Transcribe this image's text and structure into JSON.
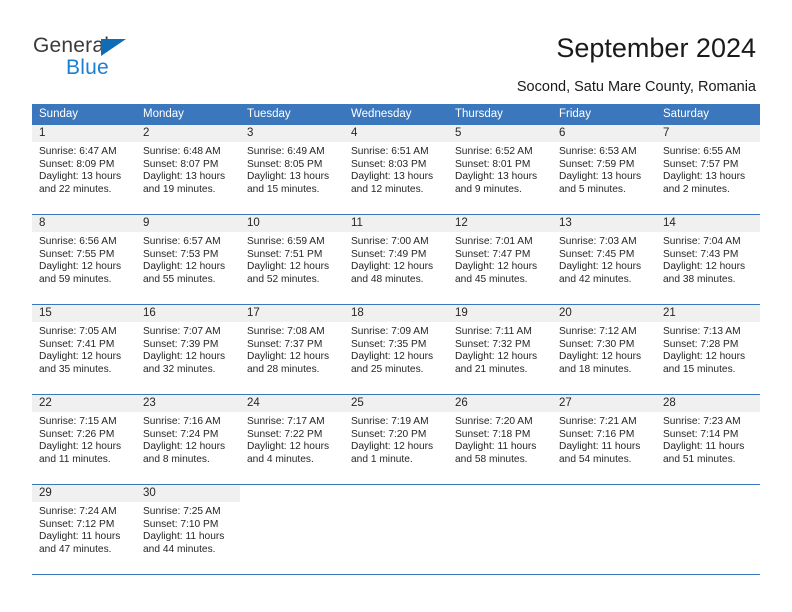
{
  "brand": {
    "name_top": "General",
    "name_bottom": "Blue",
    "accent_color": "#1b7fd4",
    "triangle_color": "#0f6cb5"
  },
  "header": {
    "title": "September 2024",
    "subtitle": "Socond, Satu Mare County, Romania",
    "header_bg": "#3b77bd",
    "header_text_color": "#ffffff",
    "daynum_band_bg": "#f0f0f0"
  },
  "weekdays": [
    "Sunday",
    "Monday",
    "Tuesday",
    "Wednesday",
    "Thursday",
    "Friday",
    "Saturday"
  ],
  "weeks": [
    [
      {
        "num": "1",
        "sunrise": "Sunrise: 6:47 AM",
        "sunset": "Sunset: 8:09 PM",
        "daylight1": "Daylight: 13 hours",
        "daylight2": "and 22 minutes."
      },
      {
        "num": "2",
        "sunrise": "Sunrise: 6:48 AM",
        "sunset": "Sunset: 8:07 PM",
        "daylight1": "Daylight: 13 hours",
        "daylight2": "and 19 minutes."
      },
      {
        "num": "3",
        "sunrise": "Sunrise: 6:49 AM",
        "sunset": "Sunset: 8:05 PM",
        "daylight1": "Daylight: 13 hours",
        "daylight2": "and 15 minutes."
      },
      {
        "num": "4",
        "sunrise": "Sunrise: 6:51 AM",
        "sunset": "Sunset: 8:03 PM",
        "daylight1": "Daylight: 13 hours",
        "daylight2": "and 12 minutes."
      },
      {
        "num": "5",
        "sunrise": "Sunrise: 6:52 AM",
        "sunset": "Sunset: 8:01 PM",
        "daylight1": "Daylight: 13 hours",
        "daylight2": "and 9 minutes."
      },
      {
        "num": "6",
        "sunrise": "Sunrise: 6:53 AM",
        "sunset": "Sunset: 7:59 PM",
        "daylight1": "Daylight: 13 hours",
        "daylight2": "and 5 minutes."
      },
      {
        "num": "7",
        "sunrise": "Sunrise: 6:55 AM",
        "sunset": "Sunset: 7:57 PM",
        "daylight1": "Daylight: 13 hours",
        "daylight2": "and 2 minutes."
      }
    ],
    [
      {
        "num": "8",
        "sunrise": "Sunrise: 6:56 AM",
        "sunset": "Sunset: 7:55 PM",
        "daylight1": "Daylight: 12 hours",
        "daylight2": "and 59 minutes."
      },
      {
        "num": "9",
        "sunrise": "Sunrise: 6:57 AM",
        "sunset": "Sunset: 7:53 PM",
        "daylight1": "Daylight: 12 hours",
        "daylight2": "and 55 minutes."
      },
      {
        "num": "10",
        "sunrise": "Sunrise: 6:59 AM",
        "sunset": "Sunset: 7:51 PM",
        "daylight1": "Daylight: 12 hours",
        "daylight2": "and 52 minutes."
      },
      {
        "num": "11",
        "sunrise": "Sunrise: 7:00 AM",
        "sunset": "Sunset: 7:49 PM",
        "daylight1": "Daylight: 12 hours",
        "daylight2": "and 48 minutes."
      },
      {
        "num": "12",
        "sunrise": "Sunrise: 7:01 AM",
        "sunset": "Sunset: 7:47 PM",
        "daylight1": "Daylight: 12 hours",
        "daylight2": "and 45 minutes."
      },
      {
        "num": "13",
        "sunrise": "Sunrise: 7:03 AM",
        "sunset": "Sunset: 7:45 PM",
        "daylight1": "Daylight: 12 hours",
        "daylight2": "and 42 minutes."
      },
      {
        "num": "14",
        "sunrise": "Sunrise: 7:04 AM",
        "sunset": "Sunset: 7:43 PM",
        "daylight1": "Daylight: 12 hours",
        "daylight2": "and 38 minutes."
      }
    ],
    [
      {
        "num": "15",
        "sunrise": "Sunrise: 7:05 AM",
        "sunset": "Sunset: 7:41 PM",
        "daylight1": "Daylight: 12 hours",
        "daylight2": "and 35 minutes."
      },
      {
        "num": "16",
        "sunrise": "Sunrise: 7:07 AM",
        "sunset": "Sunset: 7:39 PM",
        "daylight1": "Daylight: 12 hours",
        "daylight2": "and 32 minutes."
      },
      {
        "num": "17",
        "sunrise": "Sunrise: 7:08 AM",
        "sunset": "Sunset: 7:37 PM",
        "daylight1": "Daylight: 12 hours",
        "daylight2": "and 28 minutes."
      },
      {
        "num": "18",
        "sunrise": "Sunrise: 7:09 AM",
        "sunset": "Sunset: 7:35 PM",
        "daylight1": "Daylight: 12 hours",
        "daylight2": "and 25 minutes."
      },
      {
        "num": "19",
        "sunrise": "Sunrise: 7:11 AM",
        "sunset": "Sunset: 7:32 PM",
        "daylight1": "Daylight: 12 hours",
        "daylight2": "and 21 minutes."
      },
      {
        "num": "20",
        "sunrise": "Sunrise: 7:12 AM",
        "sunset": "Sunset: 7:30 PM",
        "daylight1": "Daylight: 12 hours",
        "daylight2": "and 18 minutes."
      },
      {
        "num": "21",
        "sunrise": "Sunrise: 7:13 AM",
        "sunset": "Sunset: 7:28 PM",
        "daylight1": "Daylight: 12 hours",
        "daylight2": "and 15 minutes."
      }
    ],
    [
      {
        "num": "22",
        "sunrise": "Sunrise: 7:15 AM",
        "sunset": "Sunset: 7:26 PM",
        "daylight1": "Daylight: 12 hours",
        "daylight2": "and 11 minutes."
      },
      {
        "num": "23",
        "sunrise": "Sunrise: 7:16 AM",
        "sunset": "Sunset: 7:24 PM",
        "daylight1": "Daylight: 12 hours",
        "daylight2": "and 8 minutes."
      },
      {
        "num": "24",
        "sunrise": "Sunrise: 7:17 AM",
        "sunset": "Sunset: 7:22 PM",
        "daylight1": "Daylight: 12 hours",
        "daylight2": "and 4 minutes."
      },
      {
        "num": "25",
        "sunrise": "Sunrise: 7:19 AM",
        "sunset": "Sunset: 7:20 PM",
        "daylight1": "Daylight: 12 hours",
        "daylight2": "and 1 minute."
      },
      {
        "num": "26",
        "sunrise": "Sunrise: 7:20 AM",
        "sunset": "Sunset: 7:18 PM",
        "daylight1": "Daylight: 11 hours",
        "daylight2": "and 58 minutes."
      },
      {
        "num": "27",
        "sunrise": "Sunrise: 7:21 AM",
        "sunset": "Sunset: 7:16 PM",
        "daylight1": "Daylight: 11 hours",
        "daylight2": "and 54 minutes."
      },
      {
        "num": "28",
        "sunrise": "Sunrise: 7:23 AM",
        "sunset": "Sunset: 7:14 PM",
        "daylight1": "Daylight: 11 hours",
        "daylight2": "and 51 minutes."
      }
    ],
    [
      {
        "num": "29",
        "sunrise": "Sunrise: 7:24 AM",
        "sunset": "Sunset: 7:12 PM",
        "daylight1": "Daylight: 11 hours",
        "daylight2": "and 47 minutes."
      },
      {
        "num": "30",
        "sunrise": "Sunrise: 7:25 AM",
        "sunset": "Sunset: 7:10 PM",
        "daylight1": "Daylight: 11 hours",
        "daylight2": "and 44 minutes."
      },
      {
        "num": "",
        "sunrise": "",
        "sunset": "",
        "daylight1": "",
        "daylight2": ""
      },
      {
        "num": "",
        "sunrise": "",
        "sunset": "",
        "daylight1": "",
        "daylight2": ""
      },
      {
        "num": "",
        "sunrise": "",
        "sunset": "",
        "daylight1": "",
        "daylight2": ""
      },
      {
        "num": "",
        "sunrise": "",
        "sunset": "",
        "daylight1": "",
        "daylight2": ""
      },
      {
        "num": "",
        "sunrise": "",
        "sunset": "",
        "daylight1": "",
        "daylight2": ""
      }
    ]
  ]
}
